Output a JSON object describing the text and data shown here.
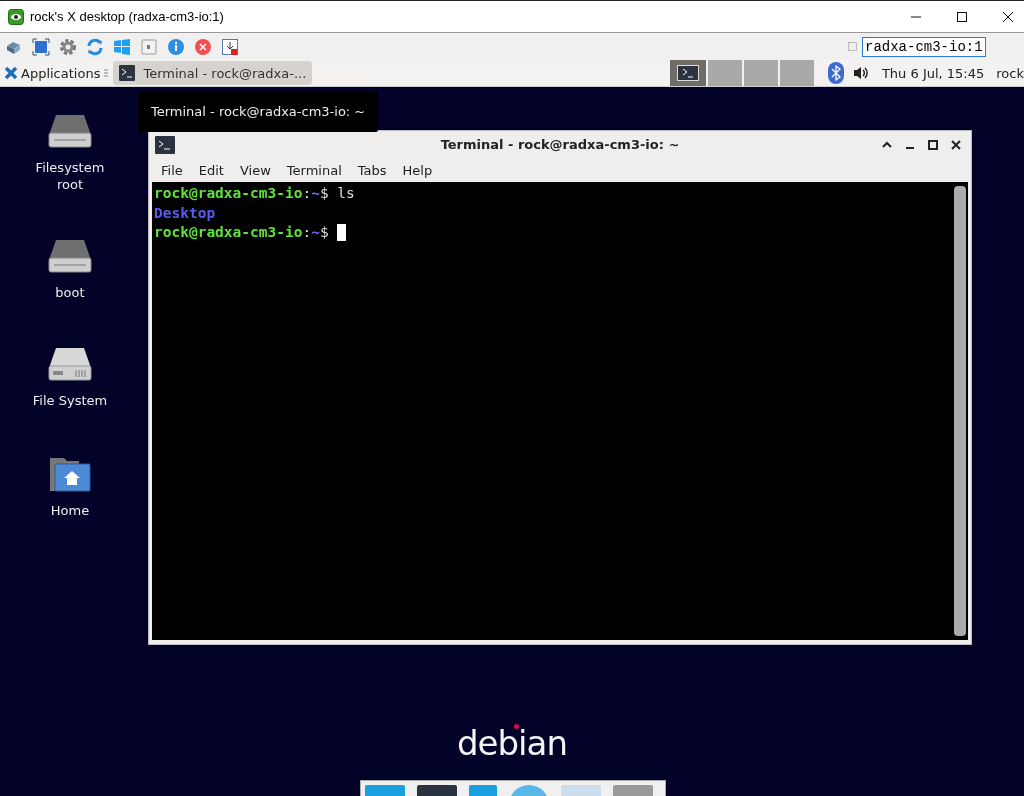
{
  "window": {
    "title": "rock's X desktop (radxa-cm3-io:1)"
  },
  "toolbar": {
    "display_field": {
      "value": "radxa-cm3-io:1"
    }
  },
  "panel": {
    "applications": "Applications",
    "task": {
      "label": "Terminal - rock@radxa-...",
      "selected": true
    },
    "workspaces": [
      {
        "selected": true,
        "has_window": true
      },
      {
        "selected": false,
        "has_window": false
      },
      {
        "selected": false,
        "has_window": false
      },
      {
        "selected": false,
        "has_window": false
      }
    ],
    "clock": "Thu  6 Jul, 15:45",
    "user": "rock"
  },
  "tooltip": "Terminal - rock@radxa-cm3-io: ~",
  "desktop_icons": [
    {
      "kind": "drive",
      "label": "Filesystem root"
    },
    {
      "kind": "drive",
      "label": "boot"
    },
    {
      "kind": "disk",
      "label": "File System"
    },
    {
      "kind": "home",
      "label": "Home"
    }
  ],
  "terminal": {
    "title": "Terminal - rock@radxa-cm3-io: ~",
    "menu": [
      "File",
      "Edit",
      "View",
      "Terminal",
      "Tabs",
      "Help"
    ],
    "lines": [
      {
        "cursor": false,
        "segments": [
          {
            "kind": "user",
            "text": "rock@radxa-cm3-io"
          },
          {
            "kind": "plain",
            "text": ":"
          },
          {
            "kind": "path",
            "text": "~"
          },
          {
            "kind": "plain",
            "text": "$ ls"
          }
        ]
      },
      {
        "cursor": false,
        "segments": [
          {
            "kind": "dir",
            "text": "Desktop"
          }
        ]
      },
      {
        "cursor": true,
        "segments": [
          {
            "kind": "user",
            "text": "rock@radxa-cm3-io"
          },
          {
            "kind": "plain",
            "text": ":"
          },
          {
            "kind": "path",
            "text": "~"
          },
          {
            "kind": "plain",
            "text": "$ "
          }
        ]
      }
    ]
  },
  "logo": "debian"
}
